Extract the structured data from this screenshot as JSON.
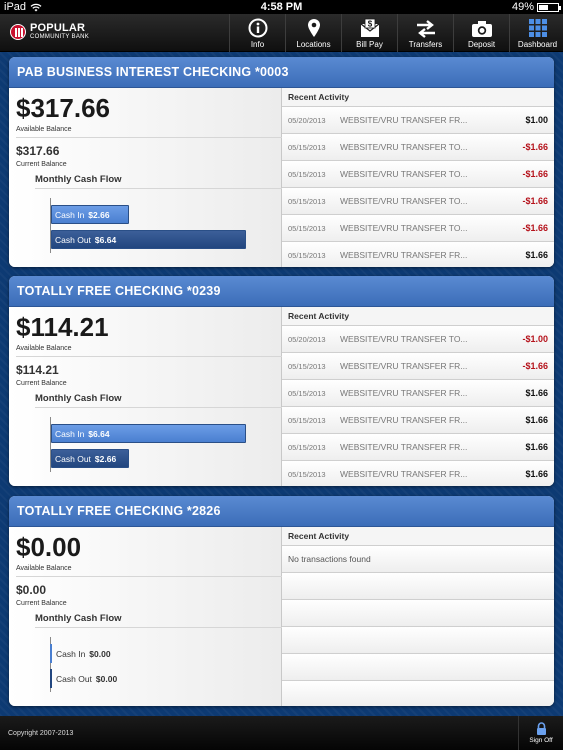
{
  "status_bar": {
    "device": "iPad",
    "time": "4:58 PM",
    "battery": "49%",
    "battery_level": 0.49
  },
  "brand": {
    "name_line1": "POPULAR",
    "name_line2": "COMMUNITY BANK",
    "accent": "#c8102e"
  },
  "nav": [
    {
      "label": "Info",
      "icon": "info-icon"
    },
    {
      "label": "Locations",
      "icon": "location-pin-icon"
    },
    {
      "label": "Bill Pay",
      "icon": "bill-pay-icon"
    },
    {
      "label": "Transfers",
      "icon": "transfers-icon"
    },
    {
      "label": "Deposit",
      "icon": "camera-icon"
    },
    {
      "label": "Dashboard",
      "icon": "dashboard-grid-icon"
    }
  ],
  "labels": {
    "available_balance": "Available Balance",
    "current_balance": "Current Balance",
    "monthly_cash_flow": "Monthly Cash Flow",
    "recent_activity": "Recent Activity",
    "cash_in": "Cash In",
    "cash_out": "Cash Out"
  },
  "accounts": [
    {
      "name": "PAB BUSINESS INTEREST CHECKING *0003",
      "available": "$317.66",
      "current": "$317.66",
      "cash_in": "$2.66",
      "cash_out": "$6.64",
      "cash_in_fraction": 0.4,
      "cash_out_fraction": 1.0,
      "transactions": [
        {
          "date": "05/20/2013",
          "desc": "WEBSITE/VRU TRANSFER FR...",
          "amount": "$1.00",
          "negative": false
        },
        {
          "date": "05/15/2013",
          "desc": "WEBSITE/VRU TRANSFER TO...",
          "amount": "-$1.66",
          "negative": true
        },
        {
          "date": "05/15/2013",
          "desc": "WEBSITE/VRU TRANSFER TO...",
          "amount": "-$1.66",
          "negative": true
        },
        {
          "date": "05/15/2013",
          "desc": "WEBSITE/VRU TRANSFER TO...",
          "amount": "-$1.66",
          "negative": true
        },
        {
          "date": "05/15/2013",
          "desc": "WEBSITE/VRU TRANSFER TO...",
          "amount": "-$1.66",
          "negative": true
        },
        {
          "date": "05/15/2013",
          "desc": "WEBSITE/VRU TRANSFER FR...",
          "amount": "$1.66",
          "negative": false
        }
      ]
    },
    {
      "name": "TOTALLY FREE CHECKING *0239",
      "available": "$114.21",
      "current": "$114.21",
      "cash_in": "$6.64",
      "cash_out": "$2.66",
      "cash_in_fraction": 1.0,
      "cash_out_fraction": 0.4,
      "transactions": [
        {
          "date": "05/20/2013",
          "desc": "WEBSITE/VRU TRANSFER TO...",
          "amount": "-$1.00",
          "negative": true
        },
        {
          "date": "05/15/2013",
          "desc": "WEBSITE/VRU TRANSFER FR...",
          "amount": "-$1.66",
          "negative": true
        },
        {
          "date": "05/15/2013",
          "desc": "WEBSITE/VRU TRANSFER FR...",
          "amount": "$1.66",
          "negative": false
        },
        {
          "date": "05/15/2013",
          "desc": "WEBSITE/VRU TRANSFER FR...",
          "amount": "$1.66",
          "negative": false
        },
        {
          "date": "05/15/2013",
          "desc": "WEBSITE/VRU TRANSFER FR...",
          "amount": "$1.66",
          "negative": false
        },
        {
          "date": "05/15/2013",
          "desc": "WEBSITE/VRU TRANSFER FR...",
          "amount": "$1.66",
          "negative": false
        }
      ]
    },
    {
      "name": "TOTALLY FREE CHECKING *2826",
      "available": "$0.00",
      "current": "$0.00",
      "cash_in": "$0.00",
      "cash_out": "$0.00",
      "cash_in_fraction": 0,
      "cash_out_fraction": 0,
      "no_transactions": "No transactions found",
      "transactions": []
    }
  ],
  "footer": {
    "copyright": "Copyright 2007-2013",
    "sign_off": "Sign Off"
  }
}
